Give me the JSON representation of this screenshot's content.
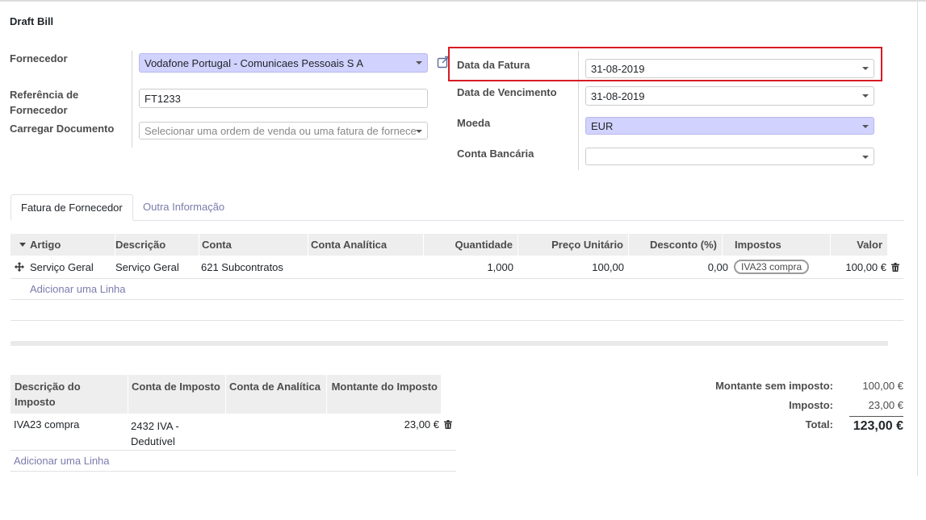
{
  "title": "Draft Bill",
  "left_fields": {
    "fornecedor_label": "Fornecedor",
    "fornecedor_value": "Vodafone Portugal - Comunicaes Pessoais S A",
    "referencia_label": "Referência de Fornecedor",
    "referencia_value": "FT1233",
    "carregar_label": "Carregar Documento",
    "carregar_placeholder": "Selecionar uma ordem de venda ou uma fatura de fornece"
  },
  "right_fields": {
    "data_fatura_label": "Data da Fatura",
    "data_fatura_value": "31-08-2019",
    "data_vencimento_label": "Data de Vencimento",
    "data_vencimento_value": "31-08-2019",
    "moeda_label": "Moeda",
    "moeda_value": "EUR",
    "conta_bancaria_label": "Conta Bancária",
    "conta_bancaria_value": ""
  },
  "tabs": [
    {
      "label": "Fatura de Fornecedor",
      "active": true
    },
    {
      "label": "Outra Informação",
      "active": false
    }
  ],
  "lines_table": {
    "headers": [
      "Artigo",
      "Descrição",
      "Conta",
      "Conta Analítica",
      "Quantidade",
      "Preço Unitário",
      "Desconto (%)",
      "Impostos",
      "Valor"
    ],
    "rows": [
      {
        "artigo": "Serviço Geral",
        "descricao": "Serviço Geral",
        "conta": "621 Subcontratos",
        "conta_analitica": "",
        "quantidade": "1,000",
        "preco_unitario": "100,00",
        "desconto": "0,00",
        "impostos": "IVA23 compra",
        "valor": "100,00 €"
      }
    ],
    "add_line": "Adicionar uma Linha"
  },
  "tax_table": {
    "headers": [
      "Descrição do Imposto",
      "Conta de Imposto",
      "Conta de Analítica",
      "Montante do Imposto"
    ],
    "rows": [
      {
        "descricao": "IVA23 compra",
        "conta": "2432 IVA - Dedutível",
        "conta_analitica": "",
        "montante": "23,00 €"
      }
    ],
    "add_line": "Adicionar uma Linha"
  },
  "totals": {
    "sem_imposto_label": "Montante sem imposto:",
    "sem_imposto_value": "100,00 €",
    "imposto_label": "Imposto:",
    "imposto_value": "23,00 €",
    "total_label": "Total:",
    "total_value": "123,00 €"
  },
  "colors": {
    "required_field_bg": "#d2d2ff",
    "highlight_border": "#d81b23",
    "link": "#7c7bad"
  },
  "icons": [
    "external-link-icon",
    "caret-down-icon",
    "drag-handle-icon",
    "trash-icon",
    "sort-caret-icon"
  ]
}
